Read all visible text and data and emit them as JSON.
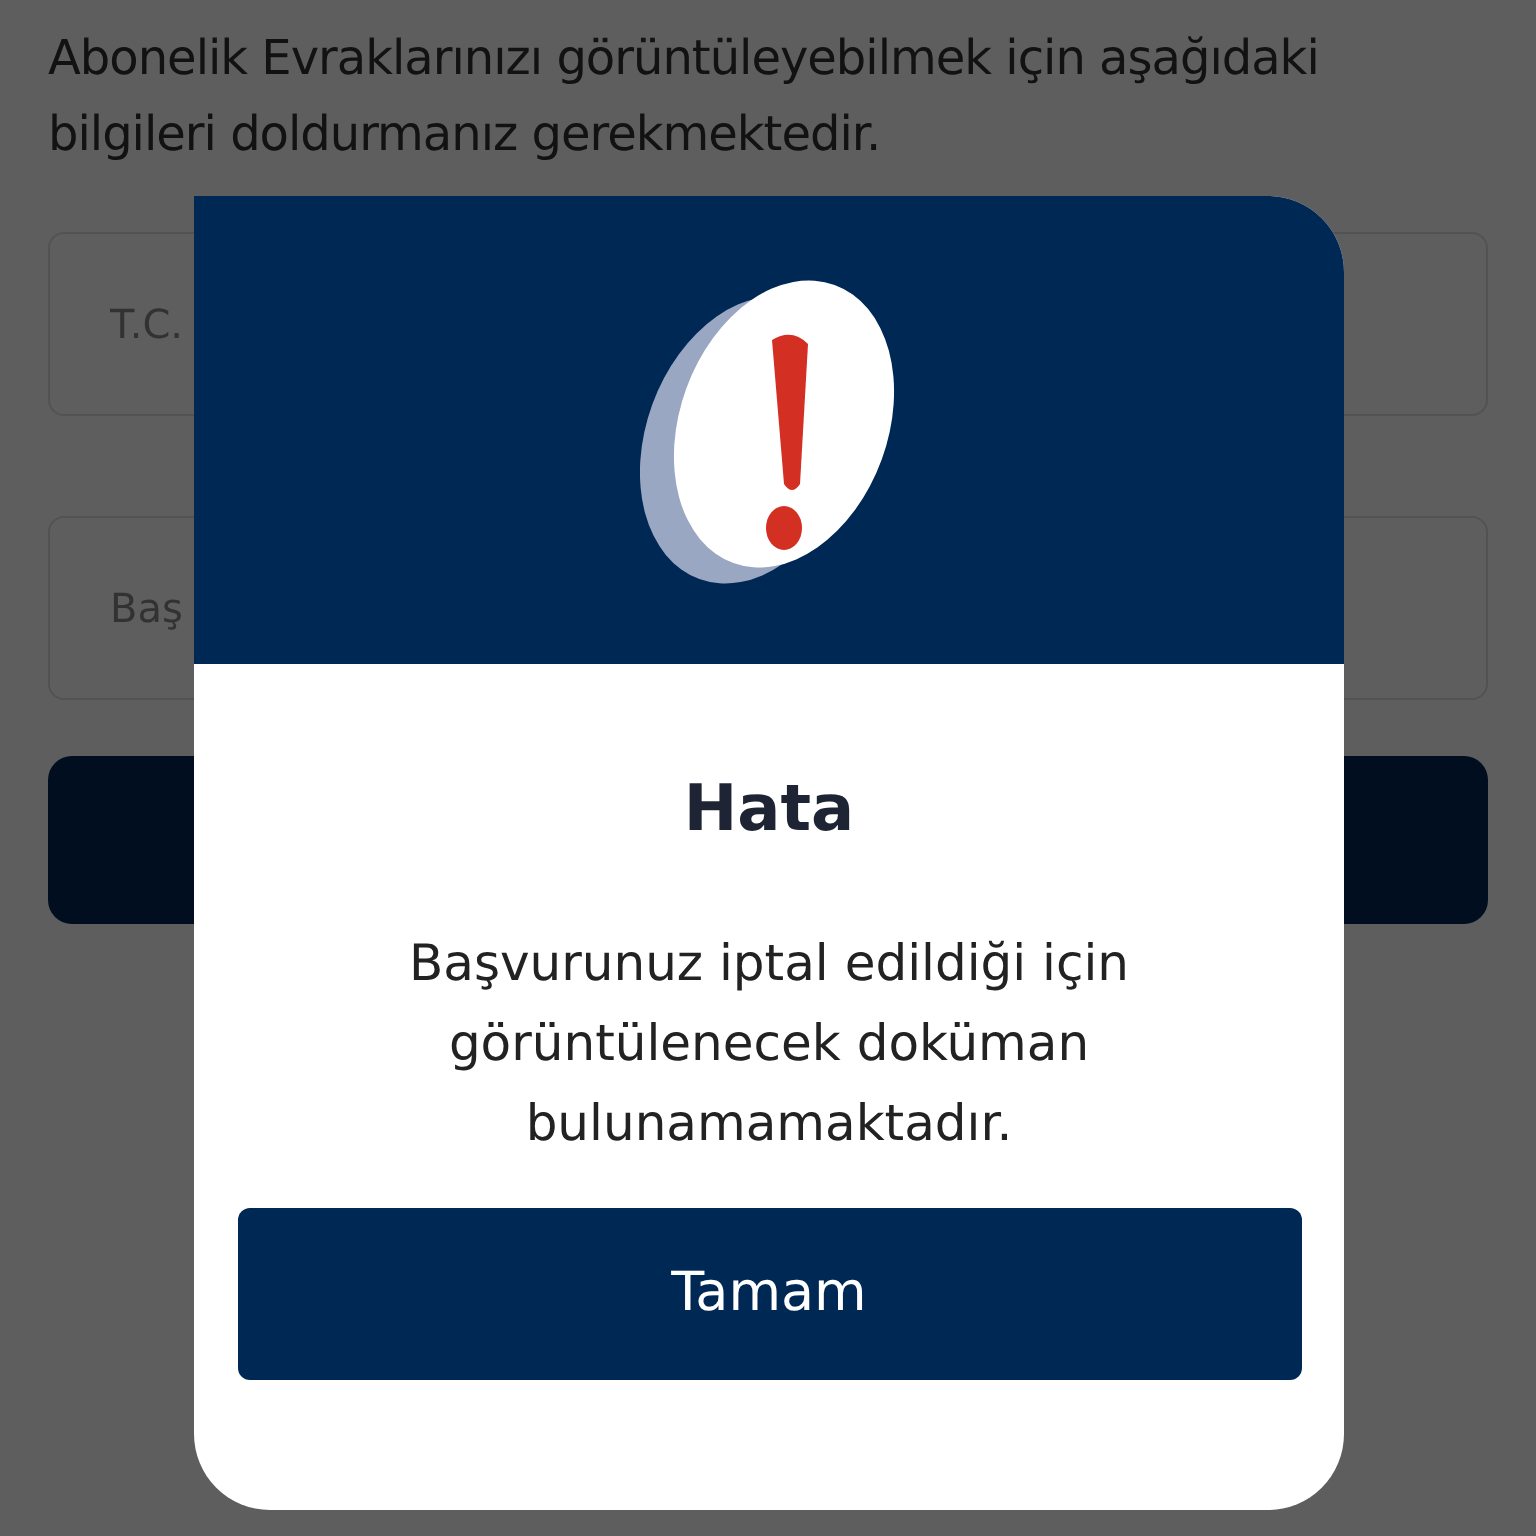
{
  "page": {
    "intro": "Abonelik Evraklarınızı görüntüleyebilmek için aşağıdaki bilgileri doldurmanız gerekmektedir.",
    "fields": [
      {
        "placeholder": "T.C."
      },
      {
        "placeholder": "Baş"
      }
    ]
  },
  "dialog": {
    "title": "Hata",
    "message": "Başvurunuz iptal edildiği için görüntülenecek doküman bulunamamaktadır.",
    "button": "Tamam"
  }
}
